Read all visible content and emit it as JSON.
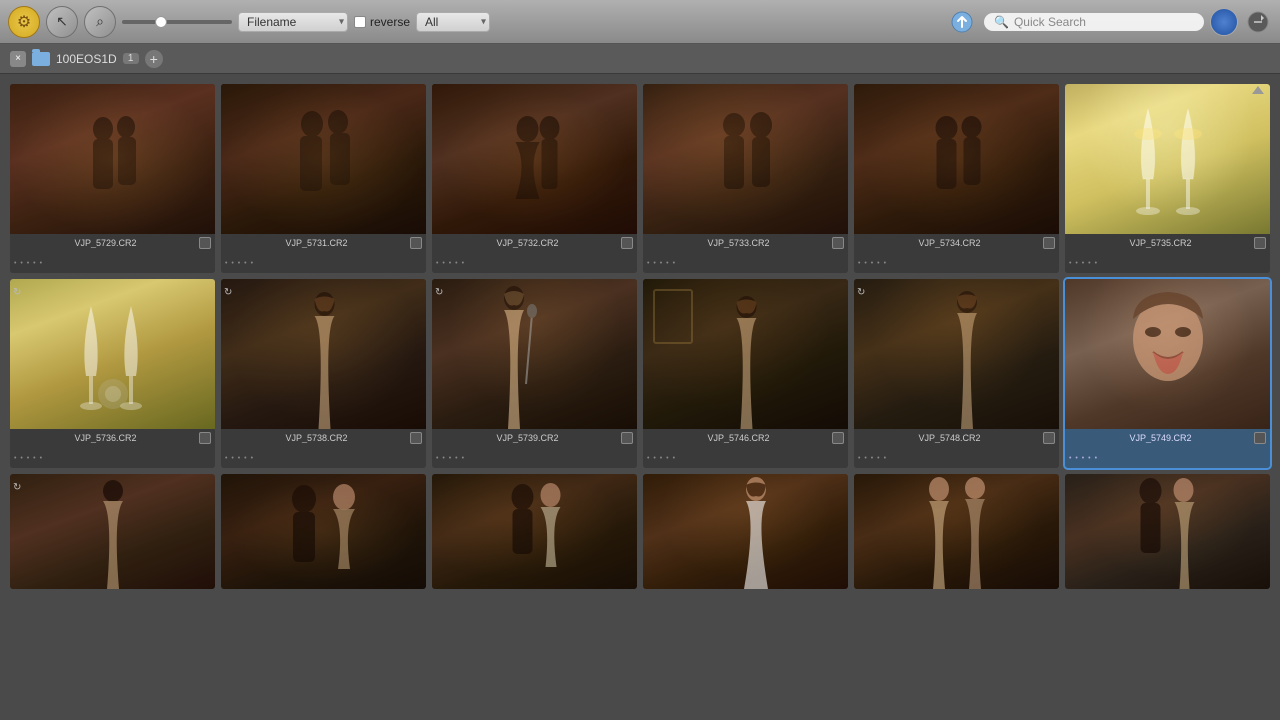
{
  "toolbar": {
    "sort_label": "Filename",
    "reverse_label": "reverse",
    "all_label": "All",
    "search_placeholder": "Quick Search",
    "slider_value": 30
  },
  "breadcrumb": {
    "folder_name": "100EOS1D",
    "badge": "1",
    "close_label": "×",
    "add_label": "+"
  },
  "photos": [
    {
      "filename": "VJP_5729.CR2",
      "stars": "• • • • •",
      "row": 1,
      "theme": "pc-1",
      "sync": false
    },
    {
      "filename": "VJP_5731.CR2",
      "stars": "• • • • •",
      "row": 1,
      "theme": "pc-2",
      "sync": false
    },
    {
      "filename": "VJP_5732.CR2",
      "stars": "• • • • •",
      "row": 1,
      "theme": "pc-3",
      "sync": false
    },
    {
      "filename": "VJP_5733.CR2",
      "stars": "• • • • •",
      "row": 1,
      "theme": "pc-4",
      "sync": false
    },
    {
      "filename": "VJP_5734.CR2",
      "stars": "• • • • •",
      "row": 1,
      "theme": "pc-5",
      "sync": false
    },
    {
      "filename": "VJP_5735.CR2",
      "stars": "• • • • •",
      "row": 1,
      "theme": "pc-6",
      "sync": false
    },
    {
      "filename": "VJP_5736.CR2",
      "stars": "• • • • •",
      "row": 2,
      "theme": "pc-7",
      "sync": true
    },
    {
      "filename": "VJP_5738.CR2",
      "stars": "• • • • •",
      "row": 2,
      "theme": "pc-8",
      "sync": true
    },
    {
      "filename": "VJP_5739.CR2",
      "stars": "• • • • •",
      "row": 2,
      "theme": "pc-9",
      "sync": true
    },
    {
      "filename": "VJP_5746.CR2",
      "stars": "• • • • •",
      "row": 2,
      "theme": "pc-10",
      "sync": false
    },
    {
      "filename": "VJP_5748.CR2",
      "stars": "• • • • •",
      "row": 2,
      "theme": "pc-11",
      "sync": true
    },
    {
      "filename": "VJP_5749.CR2",
      "stars": "• • • • •",
      "row": 2,
      "theme": "pc-12",
      "sync": false,
      "selected": true
    },
    {
      "filename": "",
      "stars": "• • • • •",
      "row": 3,
      "theme": "pc-r3",
      "sync": true
    },
    {
      "filename": "",
      "stars": "• • • • •",
      "row": 3,
      "theme": "pc-1",
      "sync": false
    },
    {
      "filename": "",
      "stars": "• • • • •",
      "row": 3,
      "theme": "pc-2",
      "sync": false
    },
    {
      "filename": "",
      "stars": "• • • • •",
      "row": 3,
      "theme": "pc-3",
      "sync": false
    },
    {
      "filename": "",
      "stars": "• • • • •",
      "row": 3,
      "theme": "pc-4",
      "sync": false
    },
    {
      "filename": "",
      "stars": "• • • • •",
      "row": 3,
      "theme": "pc-5",
      "sync": false
    }
  ],
  "icons": {
    "gear": "⚙",
    "cursor": "↖",
    "search": "🔍",
    "upload": "⬆",
    "chevron_down": "▾",
    "scroll_up": "▲",
    "sync": "↻",
    "close": "×",
    "add": "+"
  }
}
